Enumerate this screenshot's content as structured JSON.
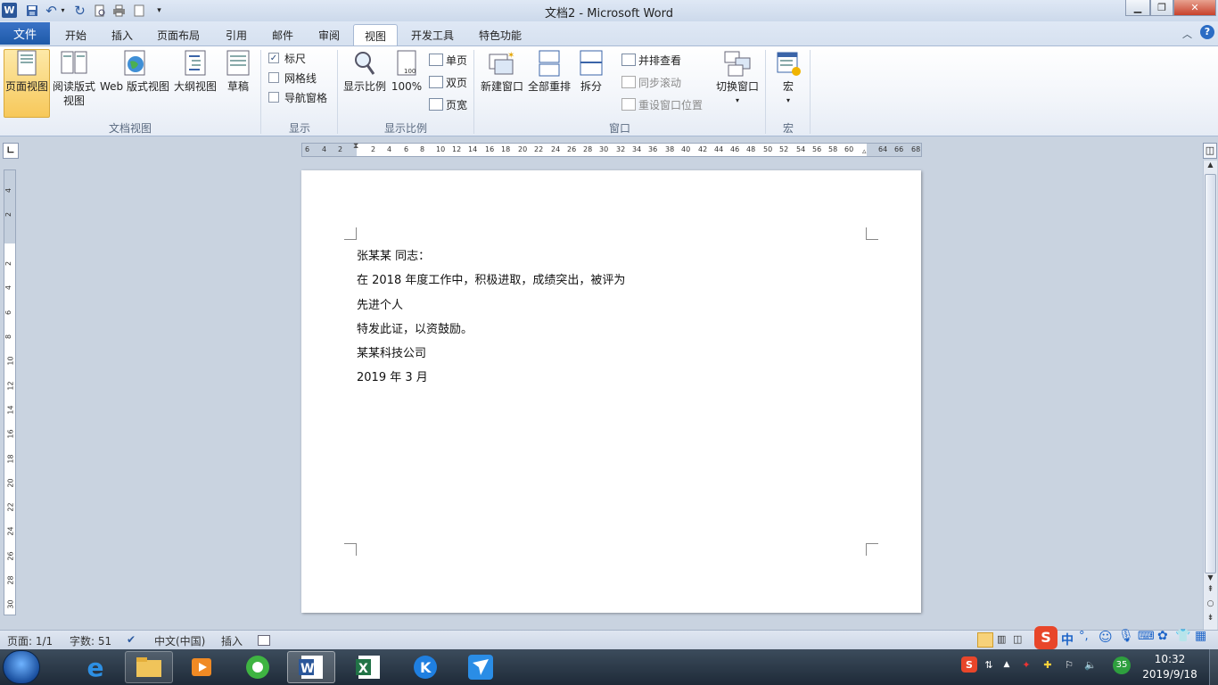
{
  "window": {
    "title": "文档2 - Microsoft Word"
  },
  "tabs": {
    "file": "文件",
    "home": "开始",
    "insert": "插入",
    "layout": "页面布局",
    "references": "引用",
    "mailings": "邮件",
    "review": "审阅",
    "view": "视图",
    "developer": "开发工具",
    "special": "特色功能"
  },
  "ribbon": {
    "doc_views": {
      "print_layout": "页面视图",
      "reading_1": "阅读版式",
      "reading_2": "视图",
      "web_layout": "Web 版式视图",
      "outline": "大纲视图",
      "draft": "草稿",
      "group": "文档视图"
    },
    "show": {
      "ruler": "标尺",
      "gridlines": "网格线",
      "nav_pane": "导航窗格",
      "group": "显示",
      "ruler_checked": true
    },
    "zoom": {
      "zoom": "显示比例",
      "hundred": "100%",
      "one_page": "单页",
      "two_pages": "双页",
      "page_width": "页宽",
      "group": "显示比例"
    },
    "window": {
      "new_window": "新建窗口",
      "arrange_all": "全部重排",
      "split": "拆分",
      "side_by_side": "并排查看",
      "sync_scroll": "同步滚动",
      "reset_pos": "重设窗口位置",
      "switch_windows": "切换窗口",
      "group": "窗口"
    },
    "macros": {
      "macros": "宏",
      "group": "宏"
    }
  },
  "ruler": {
    "h_ticks": [
      "6",
      "4",
      "2",
      "2",
      "4",
      "6",
      "8",
      "10",
      "12",
      "14",
      "16",
      "18",
      "20",
      "22",
      "24",
      "26",
      "28",
      "30",
      "32",
      "34",
      "36",
      "38",
      "40",
      "42",
      "44",
      "46",
      "48",
      "50",
      "52",
      "54",
      "56",
      "58",
      "60",
      "64",
      "66",
      "68"
    ],
    "v_ticks": [
      "4",
      "2",
      "2",
      "4",
      "6",
      "8",
      "10",
      "12",
      "14",
      "16",
      "18",
      "20",
      "22",
      "24",
      "26",
      "28",
      "30"
    ]
  },
  "document": {
    "lines": [
      "张某某  同志：",
      "在 2018 年度工作中，积极进取，成绩突出，被评为",
      "先进个人",
      "特发此证，以资鼓励。",
      "某某科技公司",
      "2019 年 3 月"
    ]
  },
  "statusbar": {
    "page": "页面: 1/1",
    "words": "字数: 51",
    "language": "中文(中国)",
    "mode": "插入"
  },
  "ime": {
    "label": "中"
  },
  "tray": {
    "badge": "35"
  },
  "clock": {
    "time": "10:32",
    "date": "2019/9/18"
  }
}
